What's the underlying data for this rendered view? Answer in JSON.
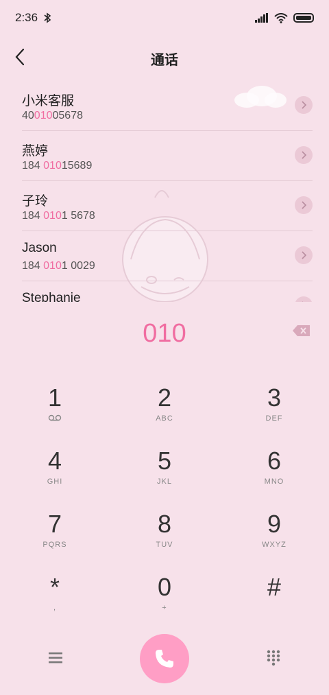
{
  "status_bar": {
    "time": "2:36"
  },
  "header": {
    "title": "通话"
  },
  "contacts": [
    {
      "name": "小米客服",
      "number_pre": "40",
      "number_match": "010",
      "number_post": "05678"
    },
    {
      "name": "燕婷",
      "number_pre": "184 ",
      "number_match": "010",
      "number_post": "15689"
    },
    {
      "name": "子玲",
      "number_pre": "184 ",
      "number_match": "010",
      "number_post": "1 5678"
    },
    {
      "name": "Jason",
      "number_pre": "184 ",
      "number_match": "010",
      "number_post": "1 0029"
    },
    {
      "name": "Stephanie",
      "number_pre": "",
      "number_match": "",
      "number_post": ""
    }
  ],
  "dial_input": {
    "value": "010"
  },
  "keypad": {
    "keys": [
      {
        "digit": "1",
        "letters": ""
      },
      {
        "digit": "2",
        "letters": "ABC"
      },
      {
        "digit": "3",
        "letters": "DEF"
      },
      {
        "digit": "4",
        "letters": "GHI"
      },
      {
        "digit": "5",
        "letters": "JKL"
      },
      {
        "digit": "6",
        "letters": "MNO"
      },
      {
        "digit": "7",
        "letters": "PQRS"
      },
      {
        "digit": "8",
        "letters": "TUV"
      },
      {
        "digit": "9",
        "letters": "WXYZ"
      },
      {
        "digit": "*",
        "letters": ","
      },
      {
        "digit": "0",
        "letters": "+"
      },
      {
        "digit": "#",
        "letters": ""
      }
    ]
  },
  "icons": {
    "back": "chevron-left-icon",
    "voicemail": "voicemail-icon",
    "backspace": "backspace-icon",
    "call": "phone-icon",
    "menu": "menu-icon",
    "keypad": "dialpad-icon"
  },
  "colors": {
    "accent": "#f06da1",
    "call_button": "#ff9ec5",
    "background": "#f7e1ea"
  }
}
